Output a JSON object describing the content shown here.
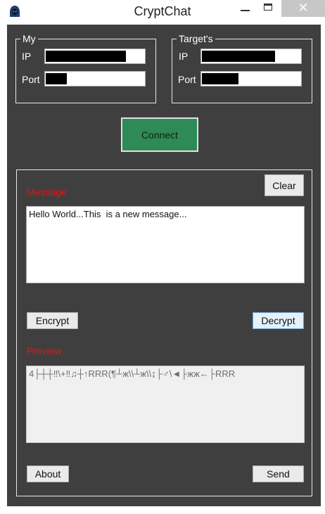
{
  "window": {
    "title": "CryptChat",
    "icon": "hooded-figure-icon",
    "close_glyph": "✕"
  },
  "my_group": {
    "legend": "My",
    "ip_label": "IP",
    "port_label": "Port"
  },
  "target_group": {
    "legend": "Target's",
    "ip_label": "IP",
    "port_label": "Port"
  },
  "connect_label": "Connect",
  "message": {
    "label": "Message",
    "clear_label": "Clear",
    "text": "Hello World...This  is a new message..."
  },
  "actions": {
    "encrypt_label": "Encrypt",
    "decrypt_label": "Decrypt"
  },
  "preview": {
    "label": "Preview",
    "text": "4├┼┼‼\\+‼♫┼↑RRR(¶┴ж\\\\┴ж\\\\↨├♂\\◄├жж←├RRR"
  },
  "footer": {
    "about_label": "About",
    "send_label": "Send"
  },
  "colors": {
    "client_bg": "#3f3f3f",
    "connect_green": "#2e8b57",
    "label_red": "#e01515"
  }
}
